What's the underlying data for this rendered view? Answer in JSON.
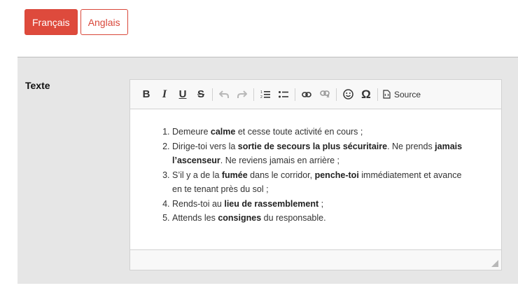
{
  "languages": [
    {
      "label": "Français",
      "active": true
    },
    {
      "label": "Anglais",
      "active": false
    }
  ],
  "field": {
    "label": "Texte"
  },
  "toolbar": {
    "bold": "B",
    "italic": "I",
    "underline": "U",
    "strike": "S",
    "special_char": "Ω",
    "source_label": "Source"
  },
  "content": {
    "items": [
      [
        {
          "t": "Demeure ",
          "b": false
        },
        {
          "t": "calme",
          "b": true
        },
        {
          "t": " et cesse toute activité en cours ;",
          "b": false
        }
      ],
      [
        {
          "t": "Dirige-toi vers la ",
          "b": false
        },
        {
          "t": "sortie de secours la plus sécuritaire",
          "b": true
        },
        {
          "t": ". Ne prends ",
          "b": false
        },
        {
          "t": "jamais l’ascenseur",
          "b": true
        },
        {
          "t": ". Ne reviens jamais en arrière ;",
          "b": false
        }
      ],
      [
        {
          "t": "S’il y a de la ",
          "b": false
        },
        {
          "t": "fumée",
          "b": true
        },
        {
          "t": " dans le corridor, ",
          "b": false
        },
        {
          "t": "penche-toi",
          "b": true
        },
        {
          "t": " immédiatement et avance en te tenant près du sol ;",
          "b": false
        }
      ],
      [
        {
          "t": "Rends-toi au ",
          "b": false
        },
        {
          "t": "lieu de rassemblement",
          "b": true
        },
        {
          "t": " ;",
          "b": false
        }
      ],
      [
        {
          "t": "Attends les ",
          "b": false
        },
        {
          "t": "consignes",
          "b": true
        },
        {
          "t": " du responsable.",
          "b": false
        }
      ]
    ]
  }
}
